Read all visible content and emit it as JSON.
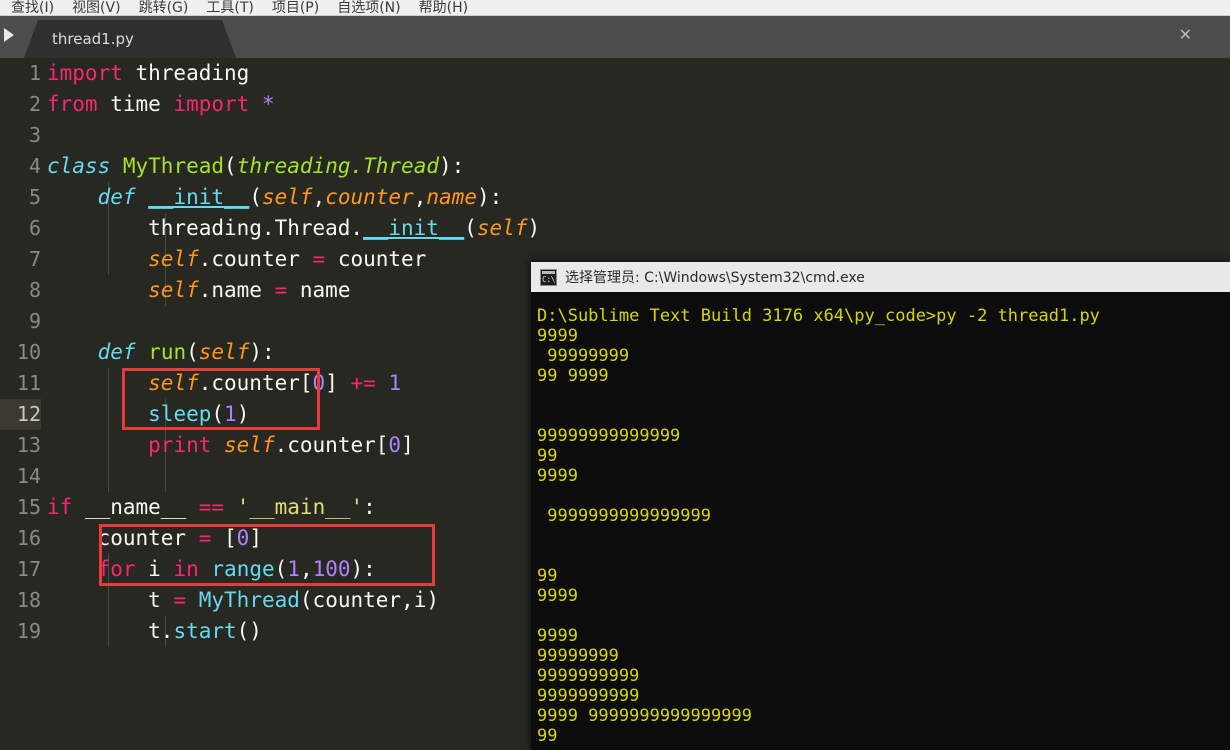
{
  "menubar": {
    "items": [
      {
        "label": "查找(I)"
      },
      {
        "label": "视图(V)"
      },
      {
        "label": "跳转(G)"
      },
      {
        "label": "工具(T)"
      },
      {
        "label": "项目(P)"
      },
      {
        "label": "自选项(N)"
      },
      {
        "label": "帮助(H)"
      }
    ]
  },
  "tabbar": {
    "sidebar_arrow_icon": "sidebar-expand-arrow-icon",
    "tab": {
      "label": "thread1.py",
      "close_icon": "✕"
    }
  },
  "editor": {
    "active_line": 12,
    "lines": [
      {
        "n": "1",
        "text": "import threading"
      },
      {
        "n": "2",
        "text": "from time import *"
      },
      {
        "n": "3",
        "text": ""
      },
      {
        "n": "4",
        "text": "class MyThread(threading.Thread):"
      },
      {
        "n": "5",
        "text": "    def __init__(self,counter,name):"
      },
      {
        "n": "6",
        "text": "        threading.Thread.__init__(self)"
      },
      {
        "n": "7",
        "text": "        self.counter = counter"
      },
      {
        "n": "8",
        "text": "        self.name = name"
      },
      {
        "n": "9",
        "text": ""
      },
      {
        "n": "10",
        "text": "    def run(self):"
      },
      {
        "n": "11",
        "text": "        self.counter[0] += 1"
      },
      {
        "n": "12",
        "text": "        sleep(1)"
      },
      {
        "n": "13",
        "text": "        print self.counter[0]"
      },
      {
        "n": "14",
        "text": ""
      },
      {
        "n": "15",
        "text": "if __name__ == '__main__':"
      },
      {
        "n": "16",
        "text": "    counter = [0]"
      },
      {
        "n": "17",
        "text": "    for i in range(1,100):"
      },
      {
        "n": "18",
        "text": "        t = MyThread(counter,i)"
      },
      {
        "n": "19",
        "text": "        t.start()"
      }
    ],
    "annotations": [
      {
        "name": "annotation-box-run-body",
        "color": "#e83b3b"
      },
      {
        "name": "annotation-box-main-loop",
        "color": "#e83b3b"
      }
    ]
  },
  "cmd": {
    "title": "选择管理员: C:\\Windows\\System32\\cmd.exe",
    "icon_label": "C:\\",
    "lines": [
      "D:\\Sublime Text Build 3176 x64\\py_code>py -2 thread1.py",
      "9999",
      " 99999999",
      "99 9999",
      "",
      "",
      "99999999999999",
      "99",
      "9999",
      "",
      " 9999999999999999",
      "",
      "",
      "99",
      "9999",
      "",
      "9999",
      "99999999",
      "9999999999",
      "9999999999",
      "9999 9999999999999999",
      "99"
    ]
  },
  "colors": {
    "editor_bg": "#272822",
    "gutter_text": "#8a8a80",
    "keyword": "#f92672",
    "function": "#a6e22e",
    "type_italic": "#66d9ef",
    "self_param": "#fd971f",
    "number": "#ae81ff",
    "string": "#e6db74",
    "text": "#f8f8f2",
    "tabbar_bg": "#4c4c4c",
    "tab_bg": "#2f2f2f",
    "menubar_bg": "#f0f0f0",
    "cmd_bg": "#0c0c0c",
    "cmd_text": "#d7d700",
    "cmd_title_bg": "#e9e9e9",
    "annotation": "#e83b3b"
  }
}
